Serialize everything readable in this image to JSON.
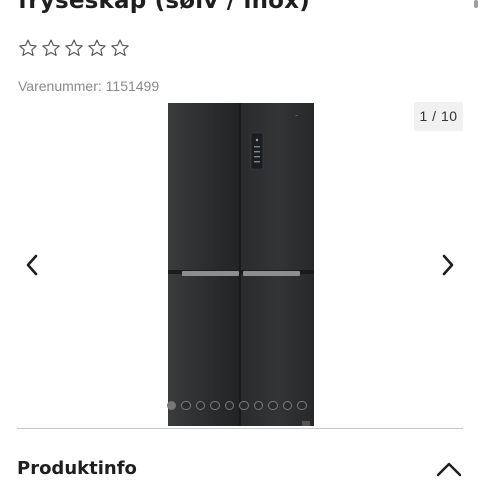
{
  "product": {
    "title": "fryseskap (sølv / inox)",
    "rating_stars": 0,
    "rating_max": 5,
    "sku_label": "Varenummer: 1151499"
  },
  "gallery": {
    "counter": "1 / 10",
    "total_images": 10,
    "active_index": 0,
    "prev_icon": "chevron-left-icon",
    "next_icon": "chevron-right-icon"
  },
  "sections": {
    "produktinfo": {
      "title": "Produktinfo",
      "icon": "chevron-up-icon",
      "expanded": true
    }
  },
  "colors": {
    "text": "#1e1e1e",
    "muted": "#8a8a8a",
    "counter_bg": "#f1f1f1",
    "appliance": "#2f3032"
  }
}
